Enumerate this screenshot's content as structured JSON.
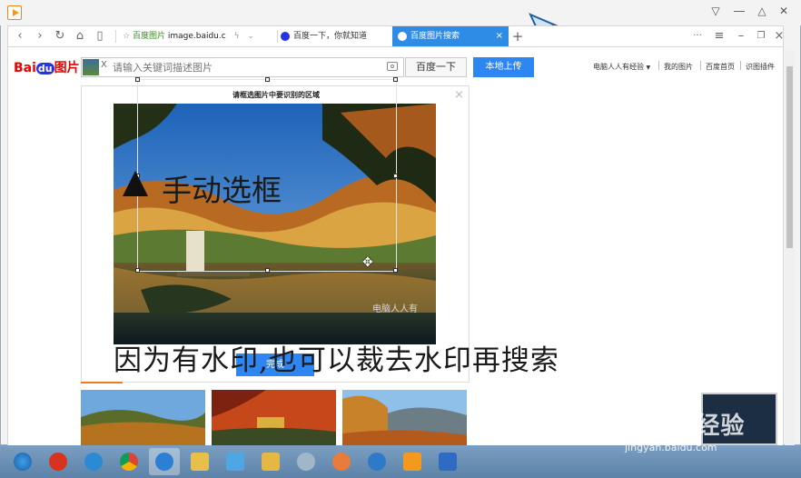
{
  "browser": {
    "tabs": [
      {
        "label": "百度图片",
        "url": "image.baidu.c"
      },
      {
        "label": "百度一下，你就知道"
      },
      {
        "label": "百度图片搜索"
      }
    ],
    "new_tab": "+",
    "menu_dots": "···"
  },
  "baidu": {
    "logo_bai": "Bai",
    "logo_du": "du",
    "logo_pic": "图片",
    "search_thumb_close": "X",
    "search_placeholder": "请输入关键词描述图片",
    "search_button": "百度一下",
    "upload_button": "本地上传",
    "top_links": [
      "电脑人人有经验",
      "我的图片",
      "百度首页",
      "识图插件"
    ]
  },
  "dialog": {
    "title": "请框选图片中要识别的区域",
    "close": "×",
    "done_button": "完成"
  },
  "annotations": {
    "overlay_text": "手动选框",
    "caption": "因为有水印,也可以裁去水印再搜索",
    "photo_watermark": "电脑人人有"
  },
  "watermark": {
    "brand": "Baidu经验",
    "url": "jingyan.baidu.com"
  },
  "colors": {
    "accent": "#2e86f2",
    "active_tab": "#2f8ce6",
    "baidu_red": "#e10602"
  },
  "taskbar_icons": [
    "windows-start-icon",
    "pinned-app-icon",
    "ie-icon",
    "chrome-icon",
    "browser-icon",
    "folder-icon",
    "network-icon",
    "explorer-icon",
    "settings-icon",
    "paint-icon",
    "media-icon",
    "video-player-icon",
    "office-icon"
  ]
}
